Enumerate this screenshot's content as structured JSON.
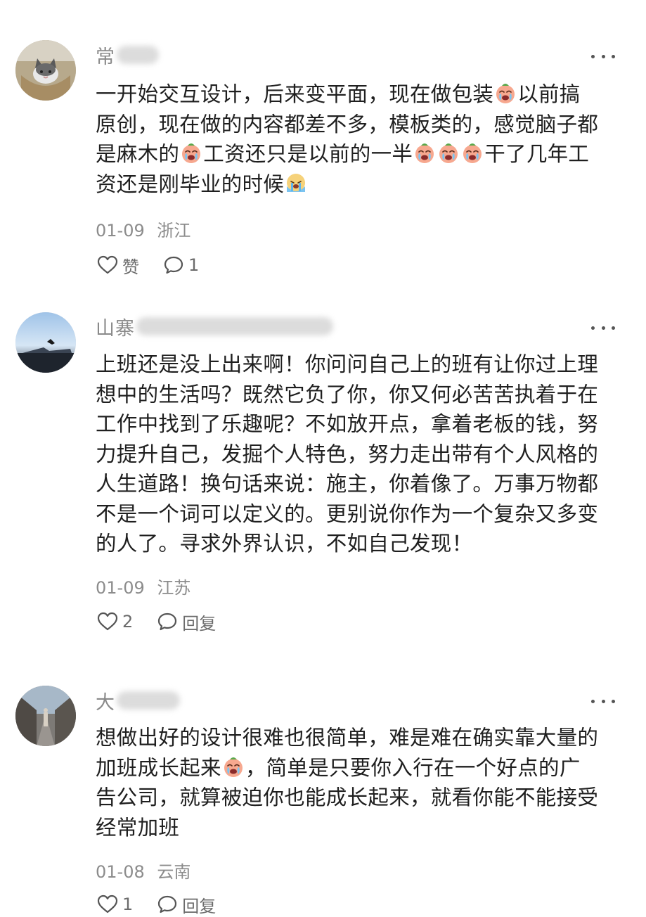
{
  "comments": [
    {
      "username_visible": "常",
      "lines": [
        [
          {
            "t": "一开始交互设计，后来变平面，现在做包装"
          },
          {
            "e": "crying-face"
          },
          {
            "t": "以前搞"
          }
        ],
        [
          {
            "t": "原创，现在做的内容都差不多，模板类的，感觉脑子都"
          }
        ],
        [
          {
            "t": "是麻木的"
          },
          {
            "e": "crying-face"
          },
          {
            "t": "工资还只是以前的一半"
          },
          {
            "e": "crying-face"
          },
          {
            "e": "crying-face"
          },
          {
            "e": "crying-face"
          },
          {
            "t": "干了几年工"
          }
        ],
        [
          {
            "t": "资还是刚毕业的时候"
          },
          {
            "e": "crying-blue-face"
          }
        ]
      ],
      "date": "01-09",
      "location": "浙江",
      "like_label": "赞",
      "reply_label": "1"
    },
    {
      "username_visible": "山寨",
      "lines": [
        [
          {
            "t": "上班还是没上出来啊！你问问自己上的班有让你过上理"
          }
        ],
        [
          {
            "t": "想中的生活吗？既然它负了你，你又何必苦苦执着于在"
          }
        ],
        [
          {
            "t": "工作中找到了乐趣呢？不如放开点，拿着老板的钱，努"
          }
        ],
        [
          {
            "t": "力提升自己，发掘个人特色，努力走出带有个人风格的"
          }
        ],
        [
          {
            "t": "人生道路！换句话来说：施主，你着像了。万事万物都"
          }
        ],
        [
          {
            "t": "不是一个词可以定义的。更别说你作为一个复杂又多变"
          }
        ],
        [
          {
            "t": "的人了。寻求外界认识，不如自己发现！"
          }
        ]
      ],
      "date": "01-09",
      "location": "江苏",
      "like_label": "2",
      "reply_label": "回复"
    },
    {
      "username_visible": "大",
      "lines": [
        [
          {
            "t": "想做出好的设计很难也很简单，难是难在确实靠大量的"
          }
        ],
        [
          {
            "t": "加班成长起来"
          },
          {
            "e": "crying-face"
          },
          {
            "t": "，简单是只要你入行在一个好点的广"
          }
        ],
        [
          {
            "t": "告公司，就算被迫你也能成长起来，就看你能不能接受"
          }
        ],
        [
          {
            "t": "经常加班"
          }
        ]
      ],
      "date": "01-08",
      "location": "云南",
      "like_label": "1",
      "reply_label": "回复"
    }
  ],
  "colors": {
    "text": "#1f1f1f",
    "meta": "#8c8c8c",
    "username": "#8a8a8a"
  }
}
